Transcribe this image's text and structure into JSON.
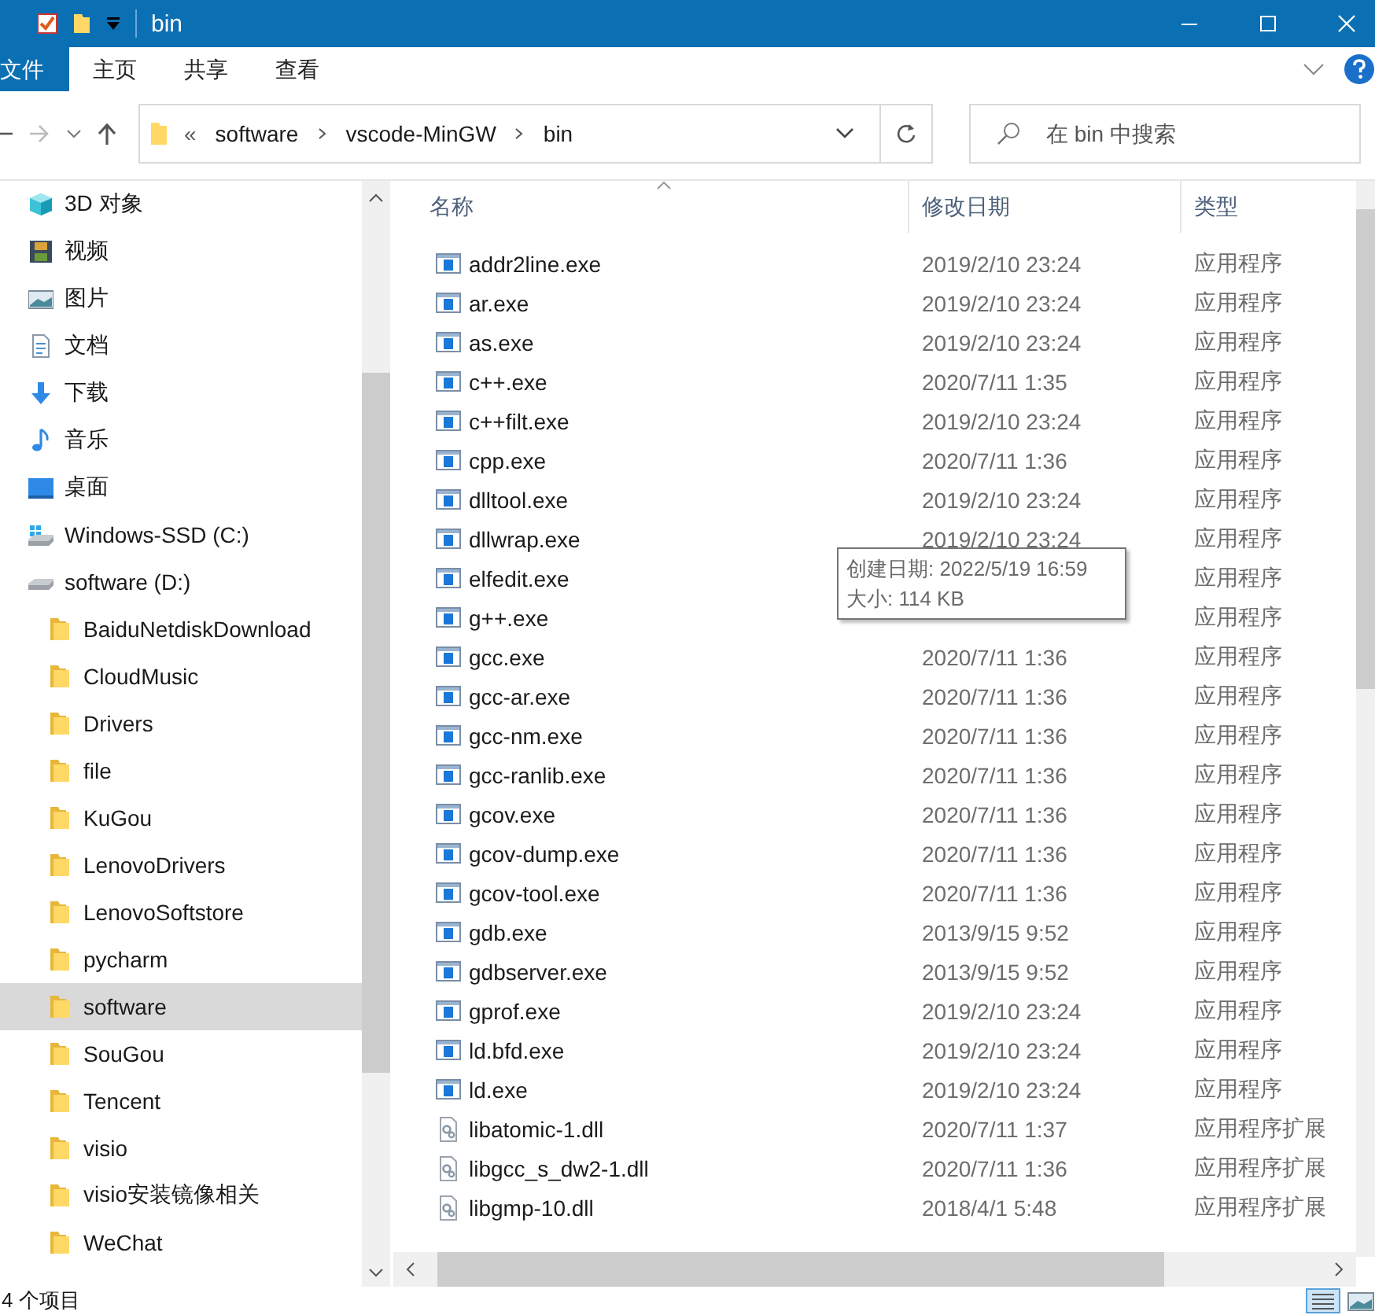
{
  "window": {
    "title": "bin"
  },
  "ribbon": {
    "tabs": [
      {
        "label": "文件",
        "kind": "file"
      },
      {
        "label": "主页",
        "kind": "tab"
      },
      {
        "label": "共享",
        "kind": "tab"
      },
      {
        "label": "查看",
        "kind": "tab"
      }
    ]
  },
  "address_bar": {
    "overflow": "«",
    "crumbs": [
      "software",
      "vscode-MinGW",
      "bin"
    ]
  },
  "search": {
    "placeholder": "在 bin 中搜索"
  },
  "nav": {
    "items": [
      {
        "label": "3D 对象",
        "kind": "cube",
        "selected": false
      },
      {
        "label": "视频",
        "kind": "video",
        "selected": false
      },
      {
        "label": "图片",
        "kind": "picture",
        "selected": false
      },
      {
        "label": "文档",
        "kind": "document",
        "selected": false
      },
      {
        "label": "下载",
        "kind": "download",
        "selected": false
      },
      {
        "label": "音乐",
        "kind": "music",
        "selected": false
      },
      {
        "label": "桌面",
        "kind": "desktop",
        "selected": false
      },
      {
        "label": "Windows-SSD (C:)",
        "kind": "system-drive",
        "selected": false
      },
      {
        "label": "software (D:)",
        "kind": "drive",
        "selected": false,
        "children": [
          {
            "label": "BaiduNetdiskDownload",
            "kind": "folder",
            "selected": false
          },
          {
            "label": "CloudMusic",
            "kind": "folder",
            "selected": false
          },
          {
            "label": "Drivers",
            "kind": "folder",
            "selected": false
          },
          {
            "label": "file",
            "kind": "folder",
            "selected": false
          },
          {
            "label": "KuGou",
            "kind": "folder",
            "selected": false
          },
          {
            "label": "LenovoDrivers",
            "kind": "folder",
            "selected": false
          },
          {
            "label": "LenovoSoftstore",
            "kind": "folder",
            "selected": false
          },
          {
            "label": "pycharm",
            "kind": "folder",
            "selected": false
          },
          {
            "label": "software",
            "kind": "folder",
            "selected": true
          },
          {
            "label": "SouGou",
            "kind": "folder",
            "selected": false
          },
          {
            "label": "Tencent",
            "kind": "folder",
            "selected": false
          },
          {
            "label": "visio",
            "kind": "folder",
            "selected": false
          },
          {
            "label": "visio安装镜像相关",
            "kind": "folder",
            "selected": false
          },
          {
            "label": "WeChat",
            "kind": "folder",
            "selected": false
          }
        ]
      }
    ]
  },
  "columns": [
    "名称",
    "修改日期",
    "类型"
  ],
  "files": [
    {
      "name": "addr2line.exe",
      "modified": "2019/2/10 23:24",
      "type": "应用程序",
      "kind": "exe"
    },
    {
      "name": "ar.exe",
      "modified": "2019/2/10 23:24",
      "type": "应用程序",
      "kind": "exe"
    },
    {
      "name": "as.exe",
      "modified": "2019/2/10 23:24",
      "type": "应用程序",
      "kind": "exe"
    },
    {
      "name": "c++.exe",
      "modified": "2020/7/11 1:35",
      "type": "应用程序",
      "kind": "exe"
    },
    {
      "name": "c++filt.exe",
      "modified": "2019/2/10 23:24",
      "type": "应用程序",
      "kind": "exe"
    },
    {
      "name": "cpp.exe",
      "modified": "2020/7/11 1:36",
      "type": "应用程序",
      "kind": "exe"
    },
    {
      "name": "dlltool.exe",
      "modified": "2019/2/10 23:24",
      "type": "应用程序",
      "kind": "exe"
    },
    {
      "name": "dllwrap.exe",
      "modified": "2019/2/10 23:24",
      "type": "应用程序",
      "kind": "exe"
    },
    {
      "name": "elfedit.exe",
      "type": "应用程序",
      "kind": "exe"
    },
    {
      "name": "g++.exe",
      "type": "应用程序",
      "kind": "exe"
    },
    {
      "name": "gcc.exe",
      "modified": "2020/7/11 1:36",
      "type": "应用程序",
      "kind": "exe"
    },
    {
      "name": "gcc-ar.exe",
      "modified": "2020/7/11 1:36",
      "type": "应用程序",
      "kind": "exe"
    },
    {
      "name": "gcc-nm.exe",
      "modified": "2020/7/11 1:36",
      "type": "应用程序",
      "kind": "exe"
    },
    {
      "name": "gcc-ranlib.exe",
      "modified": "2020/7/11 1:36",
      "type": "应用程序",
      "kind": "exe"
    },
    {
      "name": "gcov.exe",
      "modified": "2020/7/11 1:36",
      "type": "应用程序",
      "kind": "exe"
    },
    {
      "name": "gcov-dump.exe",
      "modified": "2020/7/11 1:36",
      "type": "应用程序",
      "kind": "exe"
    },
    {
      "name": "gcov-tool.exe",
      "modified": "2020/7/11 1:36",
      "type": "应用程序",
      "kind": "exe"
    },
    {
      "name": "gdb.exe",
      "modified": "2013/9/15 9:52",
      "type": "应用程序",
      "kind": "exe"
    },
    {
      "name": "gdbserver.exe",
      "modified": "2013/9/15 9:52",
      "type": "应用程序",
      "kind": "exe"
    },
    {
      "name": "gprof.exe",
      "modified": "2019/2/10 23:24",
      "type": "应用程序",
      "kind": "exe"
    },
    {
      "name": "ld.bfd.exe",
      "modified": "2019/2/10 23:24",
      "type": "应用程序",
      "kind": "exe"
    },
    {
      "name": "ld.exe",
      "modified": "2019/2/10 23:24",
      "type": "应用程序",
      "kind": "exe"
    },
    {
      "name": "libatomic-1.dll",
      "modified": "2020/7/11 1:37",
      "type": "应用程序扩展",
      "kind": "dll"
    },
    {
      "name": "libgcc_s_dw2-1.dll",
      "modified": "2020/7/11 1:36",
      "type": "应用程序扩展",
      "kind": "dll"
    },
    {
      "name": "libgmp-10.dll",
      "modified": "2018/4/1 5:48",
      "type": "应用程序扩展",
      "kind": "dll"
    }
  ],
  "tooltip": {
    "lines": [
      "创建日期: 2022/5/19 16:59",
      "大小: 114 KB"
    ]
  },
  "status_bar": {
    "count": "4 个项目"
  }
}
